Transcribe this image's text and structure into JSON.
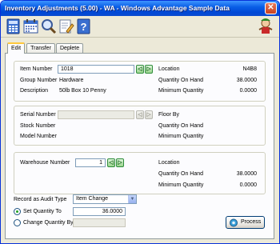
{
  "window": {
    "title": "Inventory Adjustments (5.00) - WA - Windows Advantage Sample Data",
    "close_glyph": "✕"
  },
  "toolbar": {
    "icons": [
      "calculator-icon",
      "calendar-icon",
      "search-icon",
      "edit-notes-icon",
      "help-icon"
    ],
    "help_glyph": "?"
  },
  "tabs": [
    {
      "label": "Edit"
    },
    {
      "label": "Transfer"
    },
    {
      "label": "Deplete"
    }
  ],
  "item_section": {
    "item_number_label": "Item Number",
    "item_number_value": "1018",
    "group_number_label": "Group Number",
    "group_number_value": "Hardware",
    "description_label": "Description",
    "description_value": "50lb Box 10 Penny",
    "location_label": "Location",
    "location_value": "N4B8",
    "qty_on_hand_label": "Quantity On Hand",
    "qty_on_hand_value": "38.0000",
    "min_qty_label": "Minimum Quantity",
    "min_qty_value": "0.0000"
  },
  "serial_section": {
    "serial_number_label": "Serial Number",
    "serial_number_value": "",
    "stock_number_label": "Stock Number",
    "model_number_label": "Model Number",
    "floor_by_label": "Floor By",
    "qty_on_hand_label": "Quantity On Hand",
    "min_qty_label": "Minimum Quantity"
  },
  "warehouse_section": {
    "warehouse_number_label": "Warehouse Number",
    "warehouse_number_value": "1",
    "location_label": "Location",
    "qty_on_hand_label": "Quantity On Hand",
    "qty_on_hand_value": "38.0000",
    "min_qty_label": "Minimum Quantity",
    "min_qty_value": "0.0000"
  },
  "audit": {
    "record_as_label": "Record as Audit Type",
    "record_as_value": "Item Change",
    "set_qty_label": "Set Quantity To",
    "set_qty_value": "36.0000",
    "set_qty_selected": true,
    "change_qty_label": "Change Quantity By",
    "change_qty_value": ""
  },
  "actions": {
    "process_label": "Process"
  },
  "nav_glyphs": {
    "prev": "◁",
    "next": "▷",
    "dropdown": "▼"
  },
  "colors": {
    "title_bar": "#0a5fe6",
    "tab_highlight": "#ffc83c",
    "nav_button": "#2f8c3c"
  }
}
